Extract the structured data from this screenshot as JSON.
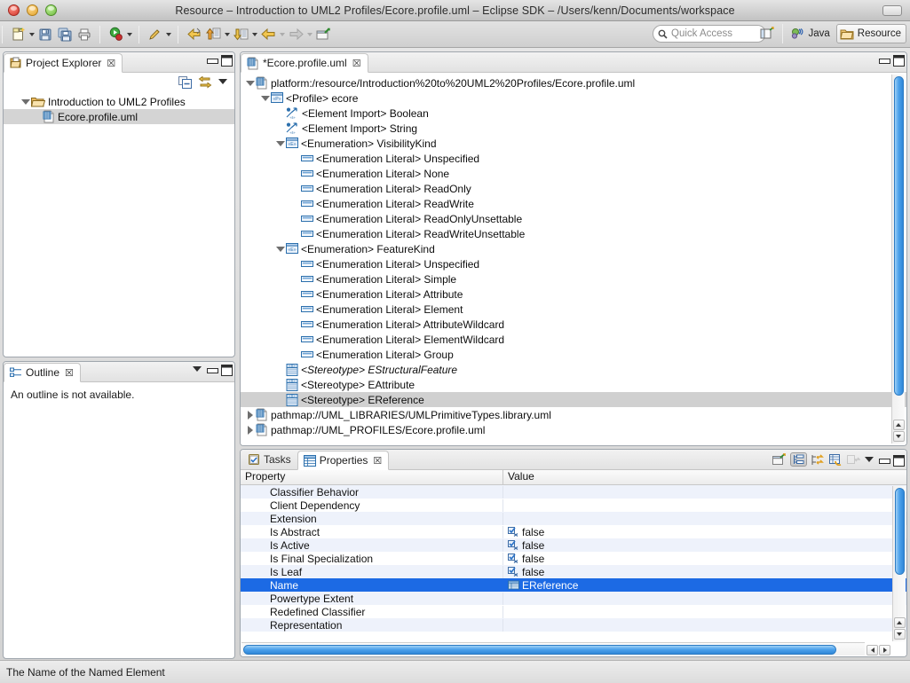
{
  "window": {
    "title": "Resource – Introduction to UML2 Profiles/Ecore.profile.uml – Eclipse SDK – /Users/kenn/Documents/workspace"
  },
  "toolbar": {
    "buttons": [
      {
        "name": "new-wizard",
        "icon": "new-file-icon",
        "has_menu": true
      },
      {
        "name": "save",
        "icon": "save-icon",
        "has_menu": false
      },
      {
        "name": "save-all",
        "icon": "save-all-icon",
        "has_menu": false
      },
      {
        "name": "print",
        "icon": "print-icon",
        "has_menu": false
      },
      {
        "name": "run",
        "icon": "run-icon",
        "has_menu": true
      },
      {
        "name": "annotation",
        "icon": "pencil-icon",
        "has_menu": true
      },
      {
        "name": "previous-annotation",
        "icon": "back-arrow-icon",
        "has_menu": false
      },
      {
        "name": "next-annotation",
        "icon": "up-arrow-doc-icon",
        "has_menu": true
      },
      {
        "name": "last-edit-location",
        "icon": "down-arrow-doc-icon",
        "has_menu": true
      },
      {
        "name": "back",
        "icon": "back-yellow-arrow-icon",
        "has_menu": true
      },
      {
        "name": "forward",
        "icon": "forward-gray-arrow-icon",
        "has_menu": true
      },
      {
        "name": "new-editor",
        "icon": "new-editor-icon",
        "has_menu": false
      }
    ],
    "quick_access": {
      "placeholder": "Quick Access",
      "value": "",
      "icon": "search-icon"
    },
    "open_perspective": {
      "name": "open-perspective",
      "icon": "open-perspective-icon"
    },
    "perspectives": [
      {
        "label": "Java",
        "icon": "java-perspective-icon",
        "active": false
      },
      {
        "label": "Resource",
        "icon": "resource-perspective-icon",
        "active": true
      }
    ]
  },
  "project_explorer": {
    "tab_label": "Project Explorer",
    "tab_icon": "project-explorer-icon",
    "close_glyph": "☒",
    "toolbar_icons": [
      "collapse-all-icon",
      "link-with-editor-icon",
      "view-menu-icon"
    ],
    "tree": [
      {
        "depth": 0,
        "twisty": "open",
        "icon": "project-folder-icon",
        "label": "Introduction to UML2 Profiles",
        "selected": false
      },
      {
        "depth": 1,
        "twisty": "none",
        "icon": "uml-file-icon",
        "label": "Ecore.profile.uml",
        "selected": true
      }
    ]
  },
  "outline": {
    "tab_label": "Outline",
    "tab_icon": "outline-icon",
    "close_glyph": "☒",
    "message": "An outline is not available."
  },
  "editor": {
    "tab_label": "*Ecore.profile.uml",
    "tab_icon": "uml-file-icon",
    "close_glyph": "☒",
    "tree": [
      {
        "depth": 0,
        "twisty": "open",
        "icon": "uml-file-icon",
        "label": "platform:/resource/Introduction%20to%20UML2%20Profiles/Ecore.profile.uml",
        "selected": false,
        "italic": false
      },
      {
        "depth": 1,
        "twisty": "open",
        "icon": "profile-icon",
        "label": "<Profile> ecore",
        "selected": false,
        "italic": false
      },
      {
        "depth": 2,
        "twisty": "none",
        "icon": "element-import-icon",
        "label": "<Element Import> Boolean",
        "selected": false,
        "italic": false
      },
      {
        "depth": 2,
        "twisty": "none",
        "icon": "element-import-icon",
        "label": "<Element Import> String",
        "selected": false,
        "italic": false
      },
      {
        "depth": 2,
        "twisty": "open",
        "icon": "enumeration-icon",
        "label": "<Enumeration> VisibilityKind",
        "selected": false,
        "italic": false
      },
      {
        "depth": 3,
        "twisty": "none",
        "icon": "enum-literal-icon",
        "label": "<Enumeration Literal> Unspecified",
        "selected": false,
        "italic": false
      },
      {
        "depth": 3,
        "twisty": "none",
        "icon": "enum-literal-icon",
        "label": "<Enumeration Literal> None",
        "selected": false,
        "italic": false
      },
      {
        "depth": 3,
        "twisty": "none",
        "icon": "enum-literal-icon",
        "label": "<Enumeration Literal> ReadOnly",
        "selected": false,
        "italic": false
      },
      {
        "depth": 3,
        "twisty": "none",
        "icon": "enum-literal-icon",
        "label": "<Enumeration Literal> ReadWrite",
        "selected": false,
        "italic": false
      },
      {
        "depth": 3,
        "twisty": "none",
        "icon": "enum-literal-icon",
        "label": "<Enumeration Literal> ReadOnlyUnsettable",
        "selected": false,
        "italic": false
      },
      {
        "depth": 3,
        "twisty": "none",
        "icon": "enum-literal-icon",
        "label": "<Enumeration Literal> ReadWriteUnsettable",
        "selected": false,
        "italic": false
      },
      {
        "depth": 2,
        "twisty": "open",
        "icon": "enumeration-icon",
        "label": "<Enumeration> FeatureKind",
        "selected": false,
        "italic": false
      },
      {
        "depth": 3,
        "twisty": "none",
        "icon": "enum-literal-icon",
        "label": "<Enumeration Literal> Unspecified",
        "selected": false,
        "italic": false
      },
      {
        "depth": 3,
        "twisty": "none",
        "icon": "enum-literal-icon",
        "label": "<Enumeration Literal> Simple",
        "selected": false,
        "italic": false
      },
      {
        "depth": 3,
        "twisty": "none",
        "icon": "enum-literal-icon",
        "label": "<Enumeration Literal> Attribute",
        "selected": false,
        "italic": false
      },
      {
        "depth": 3,
        "twisty": "none",
        "icon": "enum-literal-icon",
        "label": "<Enumeration Literal> Element",
        "selected": false,
        "italic": false
      },
      {
        "depth": 3,
        "twisty": "none",
        "icon": "enum-literal-icon",
        "label": "<Enumeration Literal> AttributeWildcard",
        "selected": false,
        "italic": false
      },
      {
        "depth": 3,
        "twisty": "none",
        "icon": "enum-literal-icon",
        "label": "<Enumeration Literal> ElementWildcard",
        "selected": false,
        "italic": false
      },
      {
        "depth": 3,
        "twisty": "none",
        "icon": "enum-literal-icon",
        "label": "<Enumeration Literal> Group",
        "selected": false,
        "italic": false
      },
      {
        "depth": 2,
        "twisty": "none",
        "icon": "stereotype-icon",
        "label": "<Stereotype> EStructuralFeature",
        "selected": false,
        "italic": true
      },
      {
        "depth": 2,
        "twisty": "none",
        "icon": "stereotype-icon",
        "label": "<Stereotype> EAttribute",
        "selected": false,
        "italic": false
      },
      {
        "depth": 2,
        "twisty": "none",
        "icon": "stereotype-icon",
        "label": "<Stereotype> EReference",
        "selected": true,
        "italic": false
      },
      {
        "depth": 0,
        "twisty": "closed",
        "icon": "uml-file-icon",
        "label": "pathmap://UML_LIBRARIES/UMLPrimitiveTypes.library.uml",
        "selected": false,
        "italic": false
      },
      {
        "depth": 0,
        "twisty": "closed",
        "icon": "uml-file-icon",
        "label": "pathmap://UML_PROFILES/Ecore.profile.uml",
        "selected": false,
        "italic": false
      }
    ]
  },
  "properties_view": {
    "tabs": [
      {
        "label": "Tasks",
        "icon": "tasks-icon",
        "active": false,
        "close_glyph": ""
      },
      {
        "label": "Properties",
        "icon": "properties-icon",
        "active": true,
        "close_glyph": "☒"
      }
    ],
    "toolbar_icons": [
      "new-editor-icon",
      "show-categories-icon",
      "show-advanced-icon",
      "restore-defaults-icon",
      "pin-icon"
    ],
    "columns": [
      "Property",
      "Value"
    ],
    "rows": [
      {
        "property": "Classifier Behavior",
        "value": "",
        "value_icon": "",
        "selected": false
      },
      {
        "property": "Client Dependency",
        "value": "",
        "value_icon": "",
        "selected": false
      },
      {
        "property": "Extension",
        "value": "",
        "value_icon": "",
        "selected": false
      },
      {
        "property": "Is Abstract",
        "value": "false",
        "value_icon": "boolean-icon",
        "selected": false
      },
      {
        "property": "Is Active",
        "value": "false",
        "value_icon": "boolean-icon",
        "selected": false
      },
      {
        "property": "Is Final Specialization",
        "value": "false",
        "value_icon": "boolean-icon",
        "selected": false
      },
      {
        "property": "Is Leaf",
        "value": "false",
        "value_icon": "boolean-icon",
        "selected": false
      },
      {
        "property": "Name",
        "value": "EReference",
        "value_icon": "string-icon",
        "selected": true
      },
      {
        "property": "Powertype Extent",
        "value": "",
        "value_icon": "",
        "selected": false
      },
      {
        "property": "Redefined Classifier",
        "value": "",
        "value_icon": "",
        "selected": false
      },
      {
        "property": "Representation",
        "value": "",
        "value_icon": "",
        "selected": false
      }
    ]
  },
  "status_bar": {
    "message": "The Name of the Named Element"
  },
  "colors": {
    "selection_blue": "#1c6ae4",
    "tree_selection_gray": "#d0d0d0",
    "row_alt": "#eef2fb",
    "scrollbar_blue": "#4ea3ec",
    "panel_border": "#9fa6ad"
  }
}
